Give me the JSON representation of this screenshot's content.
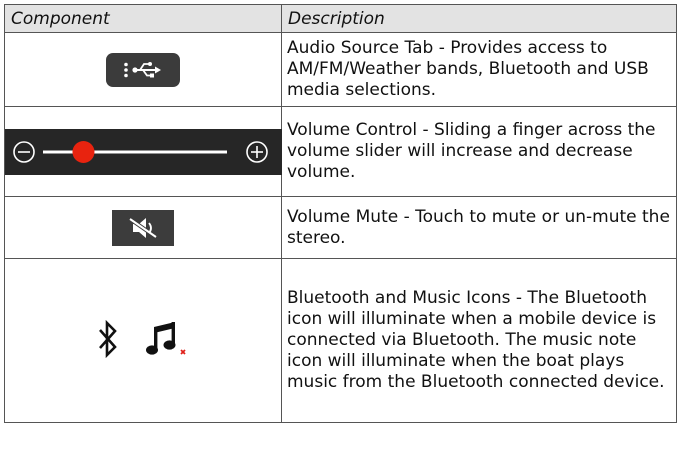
{
  "table": {
    "headers": [
      "Component",
      "Description"
    ],
    "rows": [
      {
        "icon": "usb-audio-source-icon",
        "description": "Audio Source Tab - Provides access to AM/FM/Weather bands, Bluetooth and USB media selections."
      },
      {
        "icon": "volume-slider-icon",
        "description": "Volume Control - Sliding a finger across the volume slider will increase and decrease volume."
      },
      {
        "icon": "mute-icon",
        "description": "Volume Mute - Touch to mute or un-mute the stereo."
      },
      {
        "icon": "bluetooth-music-icons",
        "description": "Bluetooth and Music Icons - The Bluetooth icon will illuminate when a mobile device is connected via Bluetooth. The music note icon will illuminate when the boat plays music from the Bluetooth connected device."
      }
    ]
  },
  "colors": {
    "header_bg": "#e3e3e3",
    "slider_knob": "#e8230f",
    "music_x": "#e0201a"
  },
  "volume_level": 0.22
}
